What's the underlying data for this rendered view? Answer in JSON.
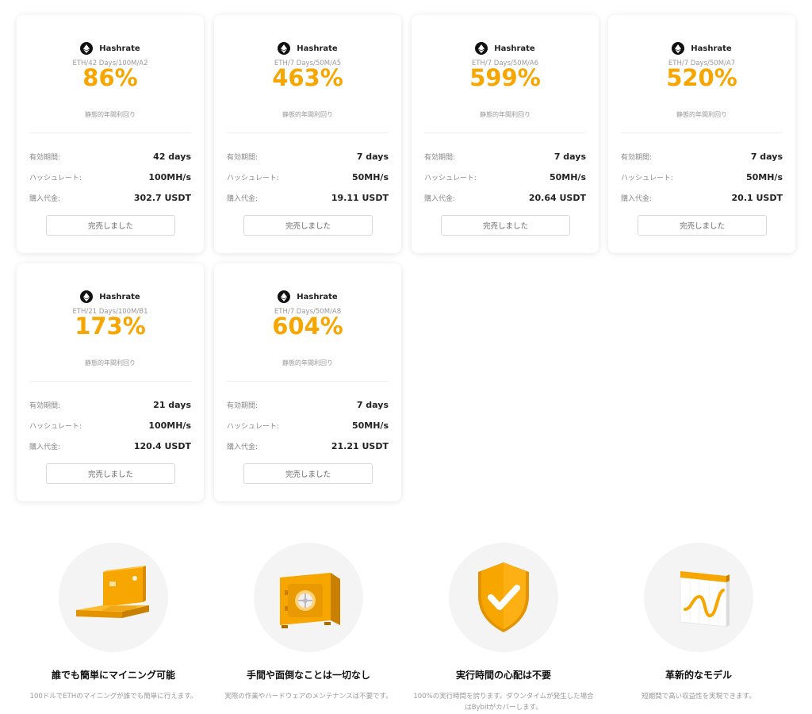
{
  "cards": [
    {
      "title": "Hashrate",
      "sub": "ETH/42 Days/100M/A2",
      "rate": "86%",
      "rate_label": "静態的年間利回り",
      "rows": [
        {
          "k": "有効期間:",
          "v": "42 days"
        },
        {
          "k": "ハッシュレート:",
          "v": "100MH/s"
        },
        {
          "k": "購入代金:",
          "v": "302.7 USDT"
        }
      ],
      "button": "完売しました"
    },
    {
      "title": "Hashrate",
      "sub": "ETH/7 Days/50M/A5",
      "rate": "463%",
      "rate_label": "静態的年間利回り",
      "rows": [
        {
          "k": "有効期間:",
          "v": "7 days"
        },
        {
          "k": "ハッシュレート:",
          "v": "50MH/s"
        },
        {
          "k": "購入代金:",
          "v": "19.11 USDT"
        }
      ],
      "button": "完売しました"
    },
    {
      "title": "Hashrate",
      "sub": "ETH/7 Days/50M/A6",
      "rate": "599%",
      "rate_label": "静態的年間利回り",
      "rows": [
        {
          "k": "有効期間:",
          "v": "7 days"
        },
        {
          "k": "ハッシュレート:",
          "v": "50MH/s"
        },
        {
          "k": "購入代金:",
          "v": "20.64 USDT"
        }
      ],
      "button": "完売しました"
    },
    {
      "title": "Hashrate",
      "sub": "ETH/7 Days/50M/A7",
      "rate": "520%",
      "rate_label": "静態的年間利回り",
      "rows": [
        {
          "k": "有効期間:",
          "v": "7 days"
        },
        {
          "k": "ハッシュレート:",
          "v": "50MH/s"
        },
        {
          "k": "購入代金:",
          "v": "20.1 USDT"
        }
      ],
      "button": "完売しました"
    },
    {
      "title": "Hashrate",
      "sub": "ETH/21 Days/100M/B1",
      "rate": "173%",
      "rate_label": "静態的年間利回り",
      "rows": [
        {
          "k": "有効期間:",
          "v": "21 days"
        },
        {
          "k": "ハッシュレート:",
          "v": "100MH/s"
        },
        {
          "k": "購入代金:",
          "v": "120.4 USDT"
        }
      ],
      "button": "完売しました"
    },
    {
      "title": "Hashrate",
      "sub": "ETH/7 Days/50M/A8",
      "rate": "604%",
      "rate_label": "静態的年間利回り",
      "rows": [
        {
          "k": "有効期間:",
          "v": "7 days"
        },
        {
          "k": "ハッシュレート:",
          "v": "50MH/s"
        },
        {
          "k": "購入代金:",
          "v": "21.21 USDT"
        }
      ],
      "button": "完売しました"
    }
  ],
  "features": [
    {
      "icon": "laptop-icon",
      "title": "誰でも簡単にマイニング可能",
      "desc": "100ドルでETHのマイニングが誰でも簡単に行えます。"
    },
    {
      "icon": "safe-icon",
      "title": "手間や面倒なことは一切なし",
      "desc": "実際の作業やハードウェアのメンテナンスは不要です。"
    },
    {
      "icon": "shield-check-icon",
      "title": "実行時間の心配は不要",
      "desc": "100%の実行時間を誇ります。ダウンタイムが発生した場合はBybitがカバーします。"
    },
    {
      "icon": "chart-calendar-icon",
      "title": "革新的なモデル",
      "desc": "短期間で高い収益性を実現できます。"
    }
  ],
  "colors": {
    "accent": "#f7a600",
    "card_bg": "#ffffff",
    "circle_bg": "#f4f4f4"
  }
}
